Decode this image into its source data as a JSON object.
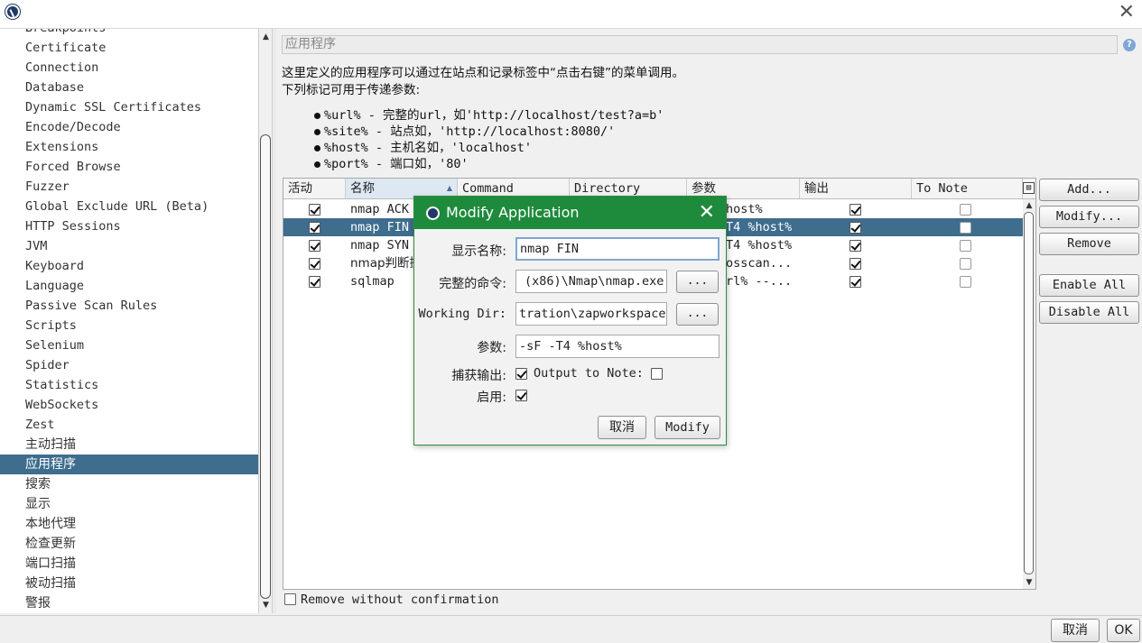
{
  "window": {
    "logo": "zap-logo-icon",
    "close_icon": "close-icon",
    "close_glyph": "✕"
  },
  "tree": {
    "items": [
      {
        "label": "Breakpoints"
      },
      {
        "label": "Certificate"
      },
      {
        "label": "Connection"
      },
      {
        "label": "Database"
      },
      {
        "label": "Dynamic SSL Certificates"
      },
      {
        "label": "Encode/Decode"
      },
      {
        "label": "Extensions"
      },
      {
        "label": "Forced Browse"
      },
      {
        "label": "Fuzzer"
      },
      {
        "label": "Global Exclude URL (Beta)"
      },
      {
        "label": "HTTP Sessions"
      },
      {
        "label": "JVM"
      },
      {
        "label": "Keyboard"
      },
      {
        "label": "Language"
      },
      {
        "label": "Passive Scan Rules"
      },
      {
        "label": "Scripts"
      },
      {
        "label": "Selenium"
      },
      {
        "label": "Spider"
      },
      {
        "label": "Statistics"
      },
      {
        "label": "WebSockets"
      },
      {
        "label": "Zest"
      },
      {
        "label": "主动扫描"
      },
      {
        "label": "应用程序"
      },
      {
        "label": "搜索"
      },
      {
        "label": "显示"
      },
      {
        "label": "本地代理"
      },
      {
        "label": "检查更新"
      },
      {
        "label": "端口扫描"
      },
      {
        "label": "被动扫描"
      },
      {
        "label": "警报"
      }
    ],
    "selected": "应用程序"
  },
  "panel": {
    "title": "应用程序",
    "desc1": "这里定义的应用程序可以通过在站点和记录标签中“点击右键”的菜单调用。",
    "desc2": "下列标记可用于传递参数:",
    "bullets": [
      "%url% - 完整的url，如'http://localhost/test?a=b'",
      "%site% - 站点如，'http://localhost:8080/'",
      "%host% - 主机名如，'localhost'",
      "%port% - 端口如，'80'"
    ]
  },
  "table": {
    "columns": [
      "活动",
      "名称",
      "Command",
      "Directory",
      "参数",
      "输出",
      "To Note"
    ],
    "rows": [
      {
        "active": true,
        "name": "nmap ACK",
        "params": "host%",
        "output": true,
        "note": false
      },
      {
        "active": true,
        "name": "nmap FIN",
        "params": "T4 %host%",
        "output": true,
        "note": false
      },
      {
        "active": true,
        "name": "nmap SYN",
        "params": "T4 %host%",
        "output": true,
        "note": false
      },
      {
        "active": true,
        "name": "nmap判断操",
        "params": "osscan...",
        "output": true,
        "note": false
      },
      {
        "active": true,
        "name": "sqlmap",
        "params": "rl% --...",
        "output": true,
        "note": false
      }
    ],
    "selected_row": 1
  },
  "side_buttons": {
    "add": "Add...",
    "modify": "Modify...",
    "remove": "Remove",
    "enable_all": "Enable All",
    "disable_all": "Disable All"
  },
  "remove_without_confirmation": "Remove without confirmation",
  "bottom": {
    "cancel": "取消",
    "ok": "OK"
  },
  "dialog": {
    "title": "Modify Application",
    "labels": {
      "display_name": "显示名称:",
      "full_command": "完整的命令:",
      "working_dir": "Working Dir:",
      "params": "参数:",
      "capture_output": "捕获输出:",
      "output_to_note": "Output to Note:",
      "enabled": "启用:"
    },
    "values": {
      "display_name": "nmap FIN",
      "full_command": "(x86)\\Nmap\\nmap.exe",
      "working_dir": "tration\\zapworkspace",
      "params": "-sF -T4 %host%"
    },
    "capture_output": true,
    "output_to_note": false,
    "enabled": true,
    "browse": "...",
    "cancel": "取消",
    "modify": "Modify"
  },
  "colors": {
    "selection": "#3e6d8d",
    "dialog_title": "#1e8a3c"
  }
}
